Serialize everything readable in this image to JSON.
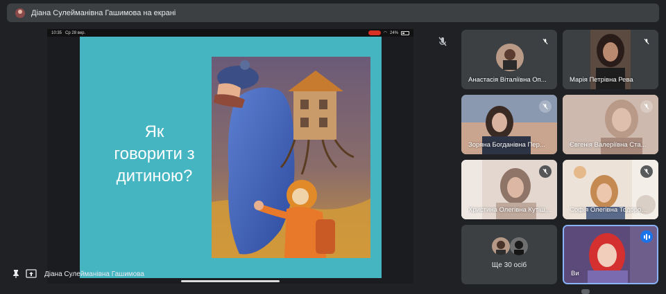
{
  "header": {
    "title": "Діана Сулейманівна Гашимова на екрані"
  },
  "stage": {
    "statusbar": {
      "time": "10:35",
      "date": "Ср 28 вер.",
      "battery": "24%"
    },
    "slide": {
      "title": "Як\nговорити з\nдитиною?"
    },
    "presenter_name": "Діана Сулейманівна Гашимова"
  },
  "participants": [
    {
      "name": "Анастасія Віталіївна Оп..."
    },
    {
      "name": "Марія Петрівна Рева"
    },
    {
      "name": "Зоряна Богданівна Пер..."
    },
    {
      "name": "Євгенія Валеріївна Ста..."
    },
    {
      "name": "Христина Олегівна Кутіш..."
    },
    {
      "name": "Софія Олегівна Тодоро..."
    }
  ],
  "more": {
    "label": "Ще 30 осіб"
  },
  "self": {
    "name": "Ви"
  },
  "colors": {
    "slide_bg": "#46b5c2",
    "active_border": "#8ab4f8",
    "speaking_badge": "#1a73e8"
  }
}
